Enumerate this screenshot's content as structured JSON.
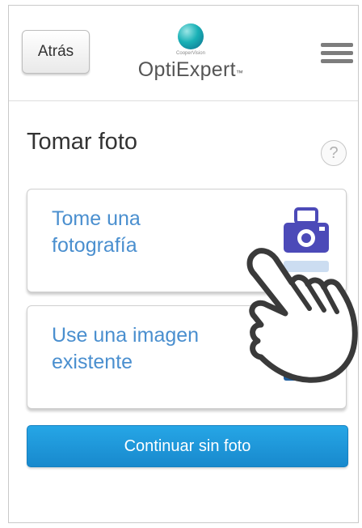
{
  "header": {
    "back_label": "Atrás",
    "logo_subtext": "CooperVision",
    "logo_text": "OptiExpert",
    "logo_tm": "™"
  },
  "page": {
    "title": "Tomar foto",
    "help_symbol": "?"
  },
  "options": {
    "take_photo_label": "Tome una fotografía",
    "use_image_label": "Use una imagen existente"
  },
  "actions": {
    "continue_label": "Continuar sin foto"
  },
  "icons": {
    "menu": "hamburger-menu-icon",
    "help": "help-icon",
    "camera": "camera-icon",
    "gallery": "gallery-icon",
    "hand": "pointing-hand-icon"
  },
  "colors": {
    "accent_blue": "#1f98dc",
    "label_blue": "#4a8fcf",
    "camera_purple": "#4c4ab8",
    "logo_teal": "#19b1b6"
  }
}
